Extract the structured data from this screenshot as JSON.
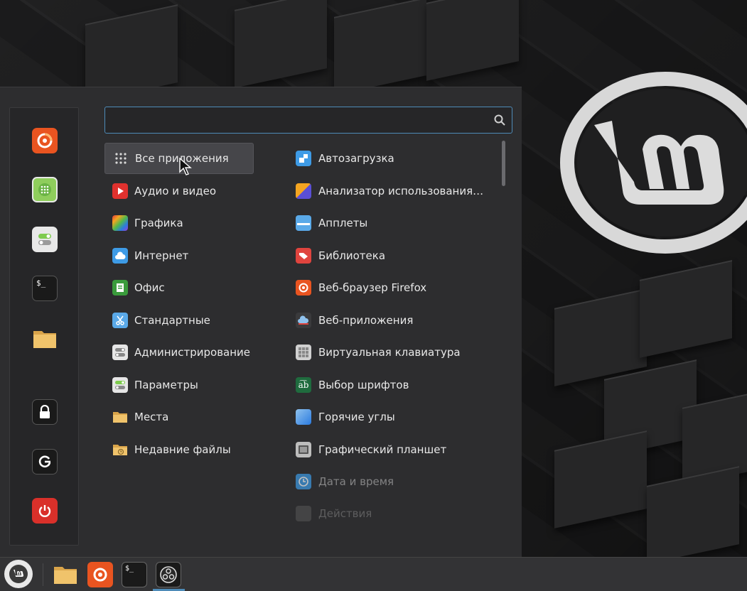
{
  "search": {
    "placeholder": "",
    "value": ""
  },
  "favorites": [
    {
      "name": "firefox-icon"
    },
    {
      "name": "software-manager-icon"
    },
    {
      "name": "settings-icon"
    },
    {
      "name": "terminal-icon"
    },
    {
      "name": "files-icon"
    }
  ],
  "session": [
    {
      "name": "lock-icon"
    },
    {
      "name": "logout-icon"
    },
    {
      "name": "power-icon"
    }
  ],
  "categories": [
    {
      "label": "Все приложения",
      "icon": "grid-icon",
      "active": true
    },
    {
      "label": "Аудио и видео",
      "icon": "media-play-icon"
    },
    {
      "label": "Графика",
      "icon": "graphics-icon"
    },
    {
      "label": "Интернет",
      "icon": "cloud-icon"
    },
    {
      "label": "Офис",
      "icon": "office-icon"
    },
    {
      "label": "Стандартные",
      "icon": "scissors-icon"
    },
    {
      "label": "Администрирование",
      "icon": "toggle-icon"
    },
    {
      "label": "Параметры",
      "icon": "toggle-icon"
    },
    {
      "label": "Места",
      "icon": "folder-icon"
    },
    {
      "label": "Недавние файлы",
      "icon": "recent-folder-icon"
    }
  ],
  "apps": [
    {
      "label": "Автозагрузка",
      "icon": "startup-icon"
    },
    {
      "label": "Анализатор использования…",
      "icon": "disk-usage-icon"
    },
    {
      "label": "Апплеты",
      "icon": "applets-icon"
    },
    {
      "label": "Библиотека",
      "icon": "library-icon"
    },
    {
      "label": "Веб-браузер Firefox",
      "icon": "firefox-icon"
    },
    {
      "label": "Веб-приложения",
      "icon": "webapps-icon"
    },
    {
      "label": "Виртуальная клавиатура",
      "icon": "keyboard-icon"
    },
    {
      "label": "Выбор шрифтов",
      "icon": "fonts-icon"
    },
    {
      "label": "Горячие углы",
      "icon": "hot-corners-icon"
    },
    {
      "label": "Графический планшет",
      "icon": "tablet-icon"
    },
    {
      "label": "Дата и время",
      "icon": "clock-icon"
    },
    {
      "label": "Действия",
      "icon": "actions-icon"
    }
  ],
  "taskbar": [
    {
      "name": "files-icon"
    },
    {
      "name": "firefox-icon"
    },
    {
      "name": "terminal-icon"
    },
    {
      "name": "obs-icon"
    }
  ],
  "colors": {
    "accent": "#4e8bb8",
    "firefox": "#e95420",
    "power": "#d9302a",
    "folder": "#f0c36b"
  }
}
